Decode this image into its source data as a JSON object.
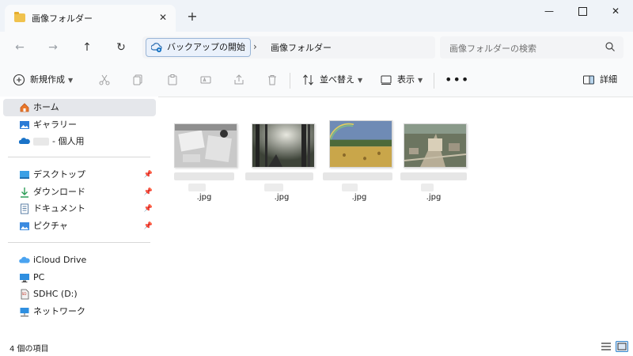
{
  "tab": {
    "title": "画像フォルダー",
    "close_icon": "close-icon"
  },
  "window": {
    "new_tab": "+"
  },
  "address": {
    "crumbs": [
      "バックアップの開始",
      "画像フォルダー"
    ],
    "separator": "›",
    "search_placeholder": "画像フォルダーの検索"
  },
  "toolbar": {
    "new_label": "新規作成",
    "sort_label": "並べ替え",
    "view_label": "表示",
    "more_label": "•••",
    "details_label": "詳細"
  },
  "sidebar": {
    "quick": [
      {
        "label": "ホーム",
        "icon": "home-icon",
        "selected": true
      },
      {
        "label": "ギャラリー",
        "icon": "gallery-icon"
      },
      {
        "label": "- 個人用",
        "icon": "onedrive-icon"
      }
    ],
    "pinned": [
      {
        "label": "デスクトップ",
        "icon": "desktop-icon"
      },
      {
        "label": "ダウンロード",
        "icon": "download-icon"
      },
      {
        "label": "ドキュメント",
        "icon": "documents-icon"
      },
      {
        "label": "ピクチャ",
        "icon": "pictures-icon"
      }
    ],
    "drives": [
      {
        "label": "iCloud Drive",
        "icon": "icloud-icon"
      },
      {
        "label": "PC",
        "icon": "pc-icon"
      },
      {
        "label": "SDHC (D:)",
        "icon": "sd-card-icon"
      },
      {
        "label": "ネットワーク",
        "icon": "network-icon"
      }
    ]
  },
  "files": [
    {
      "name": ".jpg",
      "thumb": "desk-photo"
    },
    {
      "name": ".jpg",
      "thumb": "forest-photo"
    },
    {
      "name": ".jpg",
      "thumb": "rainbow-field-photo"
    },
    {
      "name": ".jpg",
      "thumb": "aerial-city-photo"
    }
  ],
  "status": {
    "count": "4 個の項目"
  },
  "colors": {
    "accent": "#0067c0",
    "folder": "#f0c24d",
    "selected_bg": "#e5e7eb"
  }
}
